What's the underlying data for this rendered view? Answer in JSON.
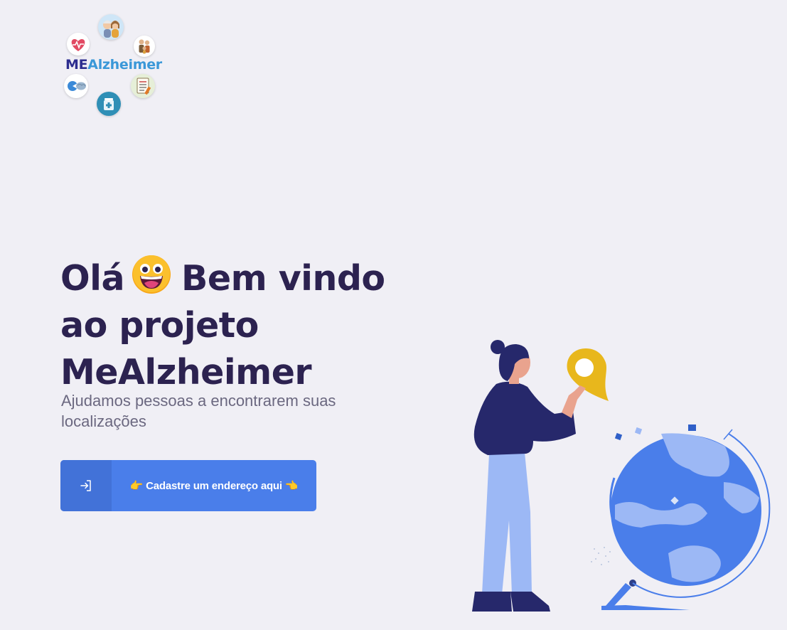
{
  "logo": {
    "part1": "ME",
    "part2": "Alzheimer",
    "icons": [
      "heart-monitor-icon",
      "elderly-couple-icon",
      "family-icon",
      "brain-icon",
      "checklist-icon",
      "medicine-icon"
    ]
  },
  "hero": {
    "title_line1_a": "Olá",
    "title_line1_b": "Bem vindo",
    "title_line2": "ao projeto",
    "title_line3": "MeAlzheimer",
    "subtitle": "Ajudamos pessoas a encontrarem suas localizações"
  },
  "cta": {
    "label": "Cadastre um endereço aqui",
    "hand_left": "👉",
    "hand_right": "👈"
  },
  "colors": {
    "background": "#f0eff5",
    "title": "#2c2250",
    "button": "#4a7eea",
    "button_icon_bg": "#4272d8",
    "pin": "#e8b71c",
    "globe": "#4a7eea"
  }
}
